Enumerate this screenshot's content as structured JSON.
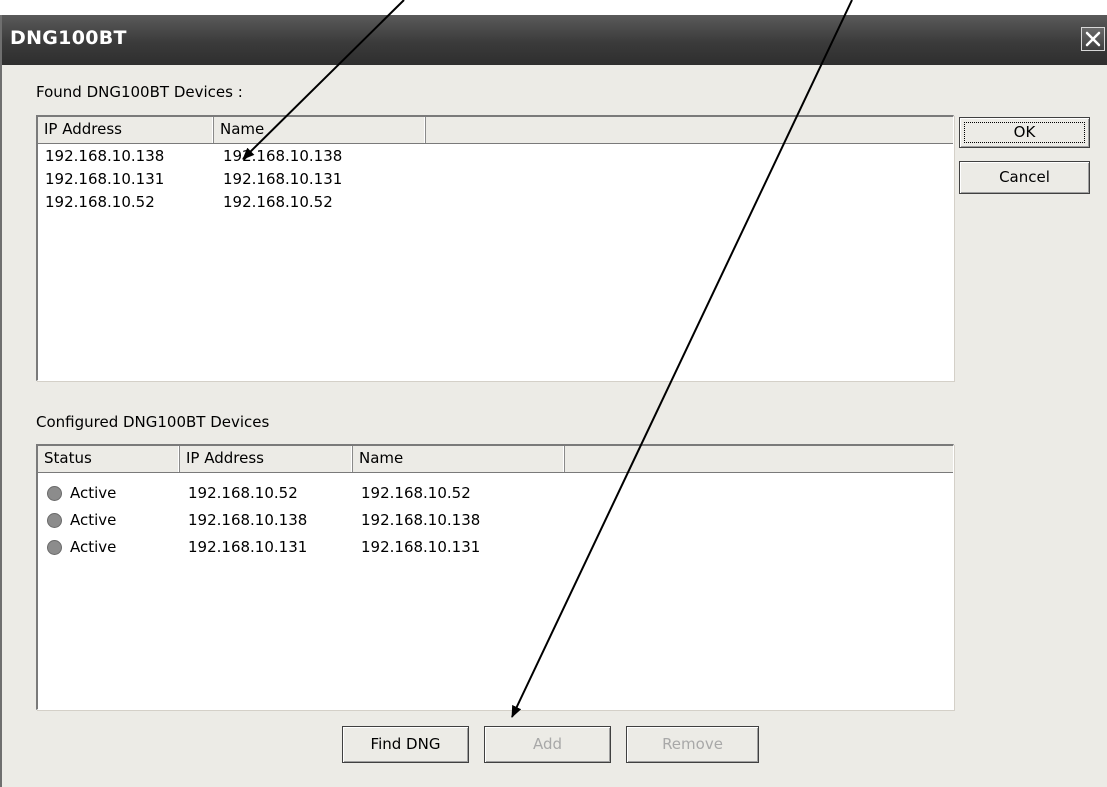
{
  "window": {
    "title": "DNG100BT",
    "close_icon": "close-icon"
  },
  "found": {
    "label": "Found DNG100BT Devices :",
    "columns": [
      "IP Address",
      "Name"
    ],
    "rows": [
      {
        "ip": "192.168.10.138",
        "name": "192.168.10.138"
      },
      {
        "ip": "192.168.10.131",
        "name": "192.168.10.131"
      },
      {
        "ip": "192.168.10.52",
        "name": "192.168.10.52"
      }
    ]
  },
  "configured": {
    "label": "Configured DNG100BT Devices",
    "columns": [
      "Status",
      "IP Address",
      "Name"
    ],
    "rows": [
      {
        "status": "Active",
        "ip": "192.168.10.52",
        "name": "192.168.10.52"
      },
      {
        "status": "Active",
        "ip": "192.168.10.138",
        "name": "192.168.10.138"
      },
      {
        "status": "Active",
        "ip": "192.168.10.131",
        "name": "192.168.10.131"
      }
    ],
    "status_color": "#8c8c8c"
  },
  "buttons": {
    "ok": "OK",
    "cancel": "Cancel",
    "find": "Find DNG",
    "add": "Add",
    "remove": "Remove"
  },
  "colors": {
    "dialog_bg": "#ecebe6",
    "titlebar": "#3b3b3b",
    "disabled_text": "#a8a8a8"
  }
}
